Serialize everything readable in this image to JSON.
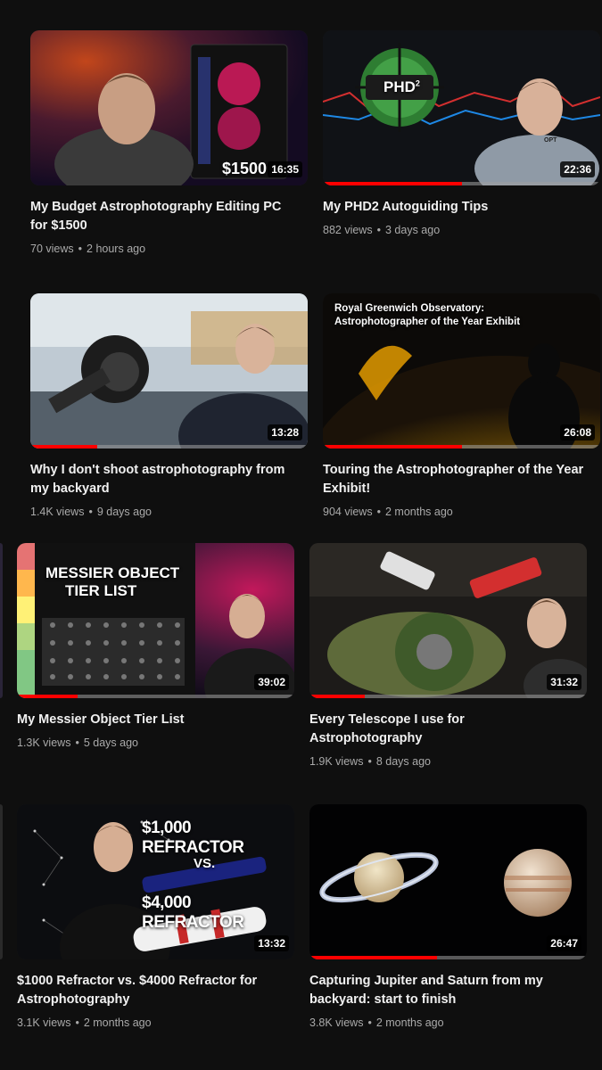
{
  "videos": [
    {
      "title": "My Budget Astrophotography Editing PC for $1500",
      "views": "70 views",
      "age": "2 hours ago",
      "duration": "16:35",
      "thumb_text": "$1500",
      "progress": 0,
      "icon": "thumbnail-image"
    },
    {
      "title": "My PHD2 Autoguiding Tips",
      "views": "882 views",
      "age": "3 days ago",
      "duration": "22:36",
      "thumb_text": "PHD",
      "thumb_sup": "2",
      "thumb_shirt": "OPT",
      "progress": 0.5,
      "icon": "thumbnail-image"
    },
    {
      "title": "Why I don't shoot astrophotography from my backyard",
      "views": "1.4K views",
      "age": "9 days ago",
      "duration": "13:28",
      "progress": 0.24,
      "icon": "thumbnail-image"
    },
    {
      "title": "Touring the Astrophotographer of the Year Exhibit!",
      "views": "904 views",
      "age": "2 months ago",
      "duration": "26:08",
      "thumb_text_line1": "Royal Greenwich Observatory:",
      "thumb_text_line2": "Astrophotographer of the Year Exhibit",
      "progress": 0.5,
      "icon": "thumbnail-image"
    },
    {
      "title": "My Messier Object Tier List",
      "views": "1.3K views",
      "age": "5 days ago",
      "duration": "39:02",
      "thumb_text_line1": "MESSIER OBJECT",
      "thumb_text_line2": "TIER LIST",
      "progress": 0.22,
      "icon": "thumbnail-image"
    },
    {
      "title": "Every Telescope I use for Astrophotography",
      "views": "1.9K views",
      "age": "8 days ago",
      "duration": "31:32",
      "progress": 0.2,
      "icon": "thumbnail-image"
    },
    {
      "title": "$1000 Refractor vs. $4000 Refractor for Astrophotography",
      "views": "3.1K views",
      "age": "2 months ago",
      "duration": "13:32",
      "thumb_text_line1": "$1,000 REFRACTOR",
      "thumb_text_vs": "VS.",
      "thumb_text_line2": "$4,000 REFRACTOR",
      "progress": 0,
      "icon": "thumbnail-image"
    },
    {
      "title": "Capturing Jupiter and Saturn from my backyard: start to finish",
      "views": "3.8K views",
      "age": "2 months ago",
      "duration": "26:47",
      "progress": 0.46,
      "icon": "thumbnail-image"
    }
  ],
  "colors": {
    "background": "#0f0f0f",
    "progress": "#ff0000",
    "meta_text": "#aaaaaa"
  }
}
